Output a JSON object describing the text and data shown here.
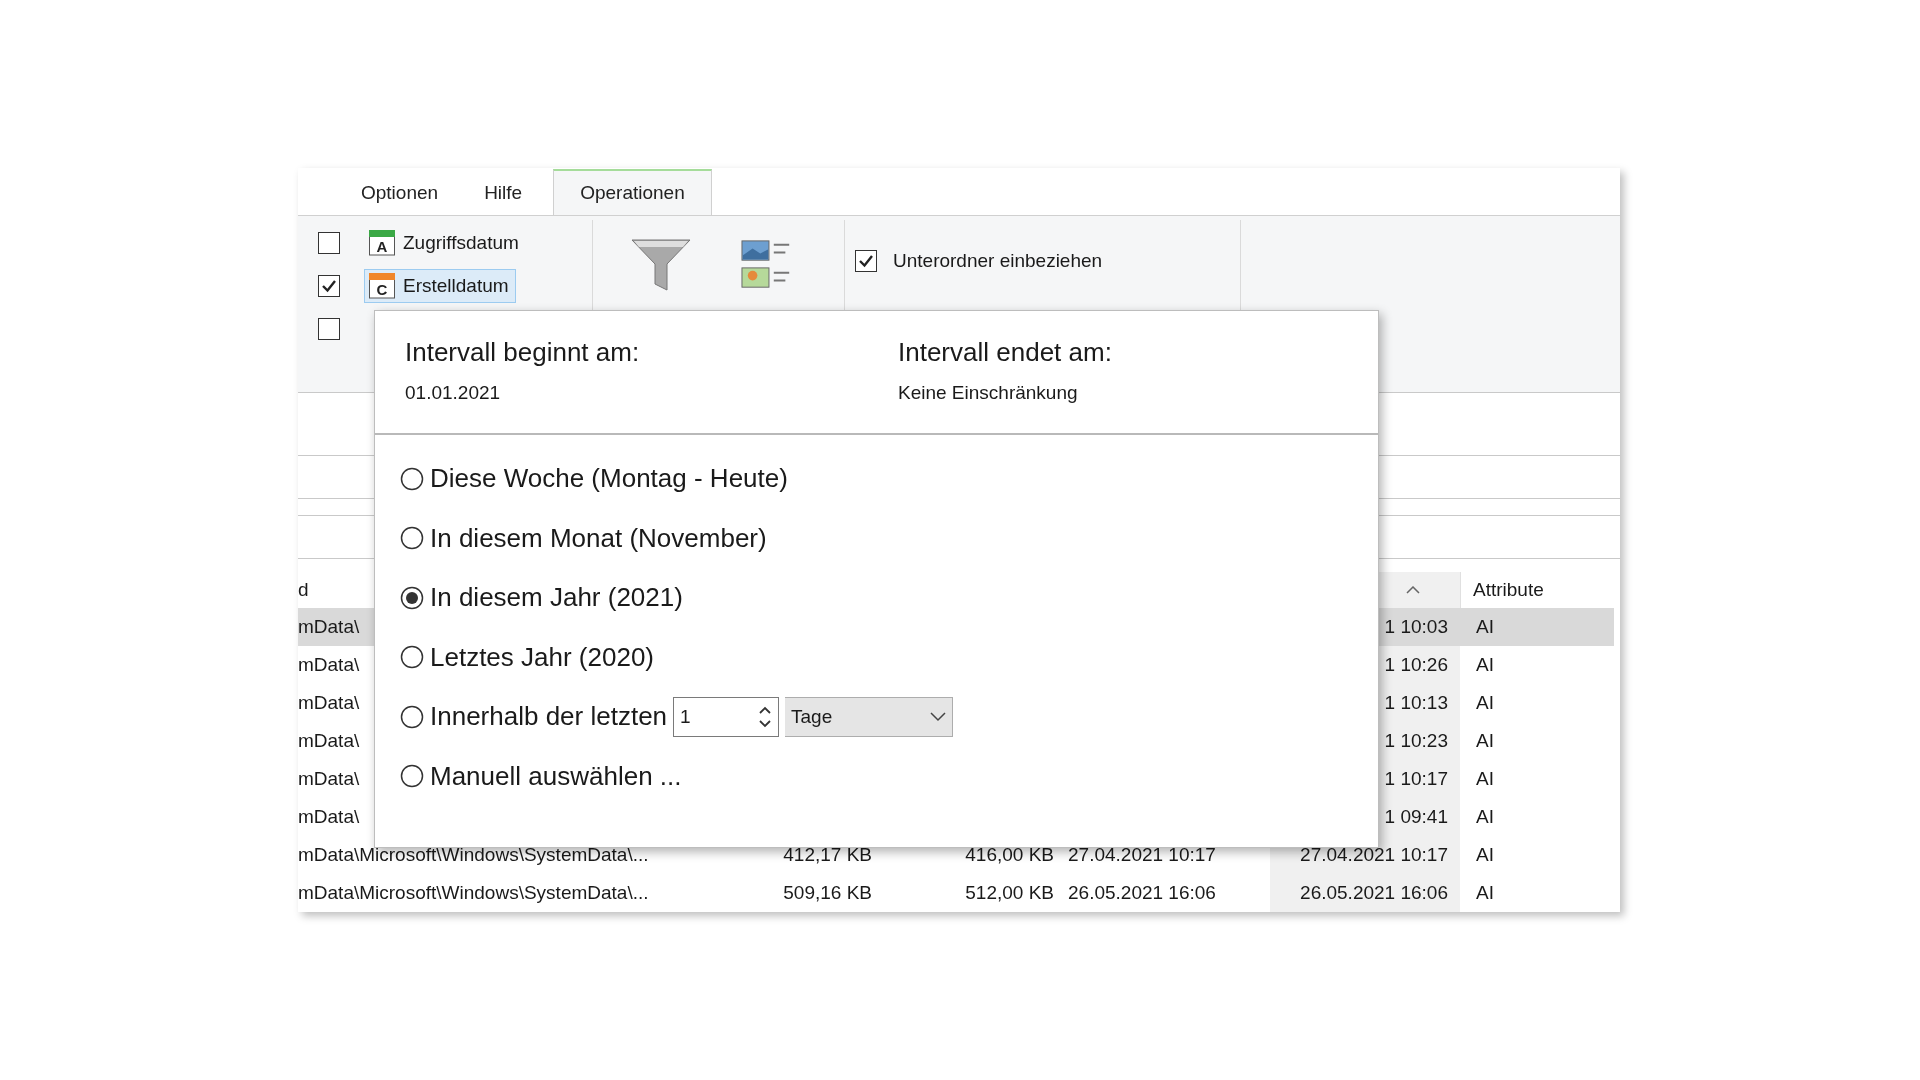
{
  "tabs": [
    {
      "label": "Optionen",
      "selected": false
    },
    {
      "label": "Hilfe",
      "selected": false
    },
    {
      "label": "Operationen",
      "selected": true
    }
  ],
  "ribbon": {
    "date_options": [
      {
        "label": "Zugriffsdatum",
        "letter": "A",
        "color": "#3aa845",
        "checked": false,
        "highlighted": false
      },
      {
        "label": "Erstelldatum",
        "letter": "C",
        "color": "#f0862a",
        "checked": true,
        "highlighted": true
      },
      {
        "checked": false
      }
    ],
    "include_subfolders": {
      "label": "Unterordner einbeziehen",
      "checked": true
    }
  },
  "table": {
    "column_1": "d",
    "column_6": "Attribute",
    "rows": [
      {
        "column_1": "mData\\",
        "column_5": "1 10:03",
        "column_6": "AI",
        "selected": true
      },
      {
        "column_1": "mData\\",
        "column_5": "1 10:26",
        "column_6": "AI",
        "selected": false
      },
      {
        "column_1": "mData\\",
        "column_5": "1 10:13",
        "column_6": "AI",
        "selected": false
      },
      {
        "column_1": "mData\\",
        "column_5": "1 10:23",
        "column_6": "AI",
        "selected": false
      },
      {
        "column_1": "mData\\",
        "column_5": "1 10:17",
        "column_6": "AI",
        "selected": false
      },
      {
        "column_1": "mData\\",
        "column_5": "1 09:41",
        "column_6": "AI",
        "selected": false
      },
      {
        "column_1": "mData\\Microsoft\\Windows\\SystemData\\...",
        "column_2": "412,17 KB",
        "column_3": "416,00 KB",
        "column_4": "27.04.2021 10:17",
        "column_5": "27.04.2021 10:17",
        "column_6": "AI",
        "selected": false
      },
      {
        "column_1": "mData\\Microsoft\\Windows\\SystemData\\...",
        "column_2": "509,16 KB",
        "column_3": "512,00 KB",
        "column_4": "26.05.2021 16:06",
        "column_5": "26.05.2021 16:06",
        "column_6": "AI",
        "selected": false
      }
    ]
  },
  "popup": {
    "start_label": "Intervall beginnt am:",
    "start_value": "01.01.2021",
    "end_label": "Intervall endet am:",
    "end_value": "Keine Einschränkung",
    "options": [
      {
        "kind": "plain",
        "label": "Diese Woche (Montag - Heute)",
        "selected": false
      },
      {
        "kind": "plain",
        "label": "In diesem Monat (November)",
        "selected": false
      },
      {
        "kind": "plain",
        "label": "In diesem Jahr (2021)",
        "selected": true
      },
      {
        "kind": "plain",
        "label": "Letztes Jahr (2020)",
        "selected": false
      },
      {
        "kind": "spinner",
        "label": "Innerhalb der letzten",
        "value": "1",
        "unit": "Tage",
        "selected": false
      },
      {
        "kind": "plain",
        "label": "Manuell auswählen ...",
        "selected": false
      }
    ]
  }
}
